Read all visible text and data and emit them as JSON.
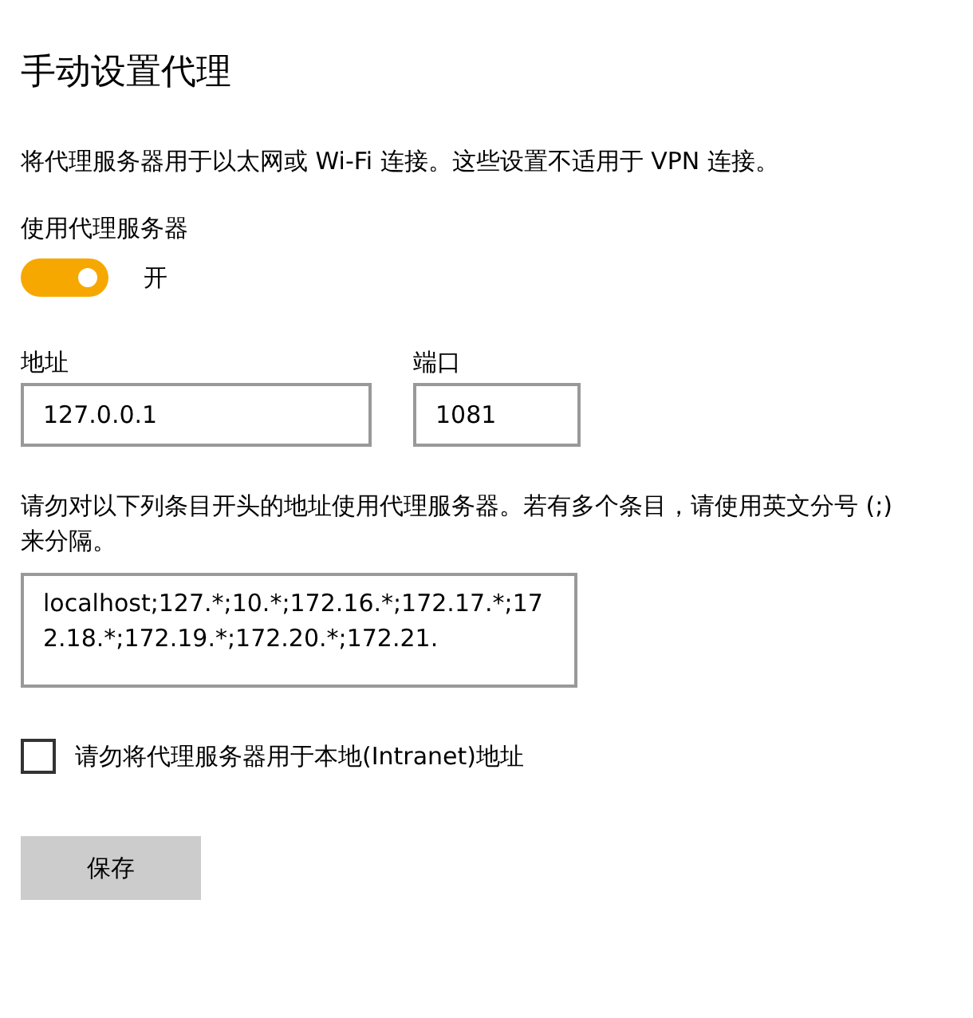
{
  "title": "手动设置代理",
  "description": "将代理服务器用于以太网或 Wi-Fi 连接。这些设置不适用于 VPN 连接。",
  "proxy_toggle": {
    "label": "使用代理服务器",
    "on": true,
    "state_text": "开"
  },
  "address": {
    "label": "地址",
    "value": "127.0.0.1"
  },
  "port": {
    "label": "端口",
    "value": "1081"
  },
  "exceptions": {
    "label": "请勿对以下列条目开头的地址使用代理服务器。若有多个条目，请使用英文分号 (;) 来分隔。",
    "value": "localhost;127.*;10.*;172.16.*;172.17.*;172.18.*;172.19.*;172.20.*;172.21."
  },
  "bypass_local": {
    "label": "请勿将代理服务器用于本地(Intranet)地址",
    "checked": false
  },
  "save_button": "保存"
}
